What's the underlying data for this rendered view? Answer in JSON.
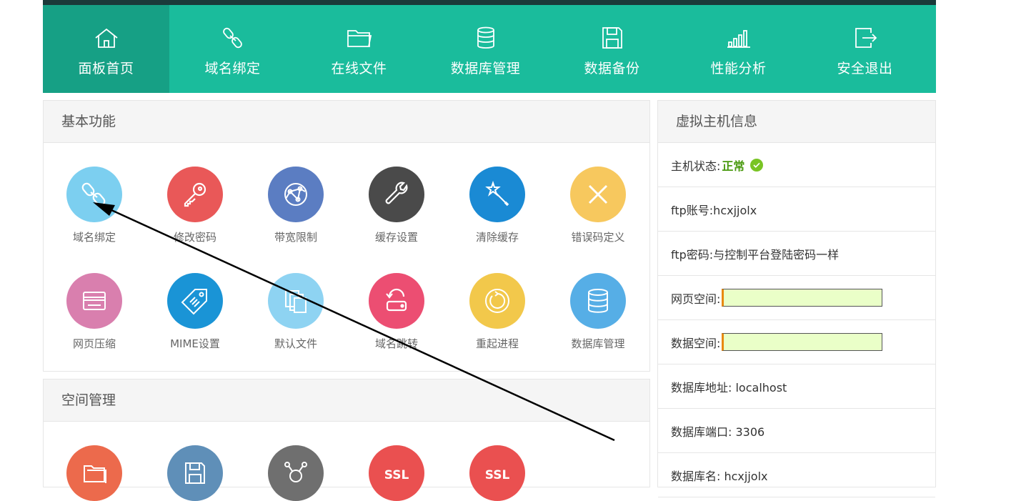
{
  "nav": {
    "items": [
      {
        "label": "面板首页",
        "icon": "home-icon"
      },
      {
        "label": "域名绑定",
        "icon": "link-icon"
      },
      {
        "label": "在线文件",
        "icon": "folder-icon"
      },
      {
        "label": "数据库管理",
        "icon": "database-icon"
      },
      {
        "label": "数据备份",
        "icon": "save-icon"
      },
      {
        "label": "性能分析",
        "icon": "signal-bars-icon"
      },
      {
        "label": "安全退出",
        "icon": "logout-icon"
      }
    ],
    "active_index": 0
  },
  "basic": {
    "title": "基本功能",
    "tiles": [
      {
        "label": "域名绑定",
        "icon": "link-icon",
        "color": "#7ccff0"
      },
      {
        "label": "修改密码",
        "icon": "key-icon",
        "color": "#e95858"
      },
      {
        "label": "带宽限制",
        "icon": "network-icon",
        "color": "#5b7dc2"
      },
      {
        "label": "缓存设置",
        "icon": "wrench-icon",
        "color": "#4a4a4a"
      },
      {
        "label": "清除缓存",
        "icon": "magic-wand-icon",
        "color": "#1a8ad4"
      },
      {
        "label": "错误码定义",
        "icon": "x-icon",
        "color": "#f7c85e"
      },
      {
        "label": "网页压缩",
        "icon": "card-icon",
        "color": "#d97fae"
      },
      {
        "label": "MIME设置",
        "icon": "tag-icon",
        "color": "#1a94d6"
      },
      {
        "label": "默认文件",
        "icon": "documents-icon",
        "color": "#8ed3f2"
      },
      {
        "label": "域名跳转",
        "icon": "redirect-icon",
        "color": "#ec4e72"
      },
      {
        "label": "重起进程",
        "icon": "restart-icon",
        "color": "#f2c84b"
      },
      {
        "label": "数据库管理",
        "icon": "database-icon",
        "color": "#56aee6"
      }
    ]
  },
  "space": {
    "title": "空间管理",
    "tiles": [
      {
        "icon": "folders-icon",
        "color": "#ec6a4c"
      },
      {
        "icon": "save-icon",
        "color": "#5f8fb8"
      },
      {
        "icon": "network-hub-icon",
        "color": "#6f6f6f"
      },
      {
        "icon": "ssl-icon",
        "text": "SSL",
        "color": "#ea5050"
      },
      {
        "icon": "ssl-icon",
        "text": "SSL",
        "color": "#ea5050"
      }
    ]
  },
  "host": {
    "title": "虚拟主机信息",
    "status_label": "主机状态:",
    "status_value": "正常",
    "ftp_account": "ftp账号:hcxjjolx",
    "ftp_password": "ftp密码:与控制平台登陆密码一样",
    "web_space_label": "网页空间:",
    "web_space_usage": 0.01,
    "db_space_label": "数据空间:",
    "db_space_usage": 0.01,
    "db_host": "数据库地址: localhost",
    "db_port": "数据库端口: 3306",
    "db_name": "数据库名: hcxjjolx"
  }
}
